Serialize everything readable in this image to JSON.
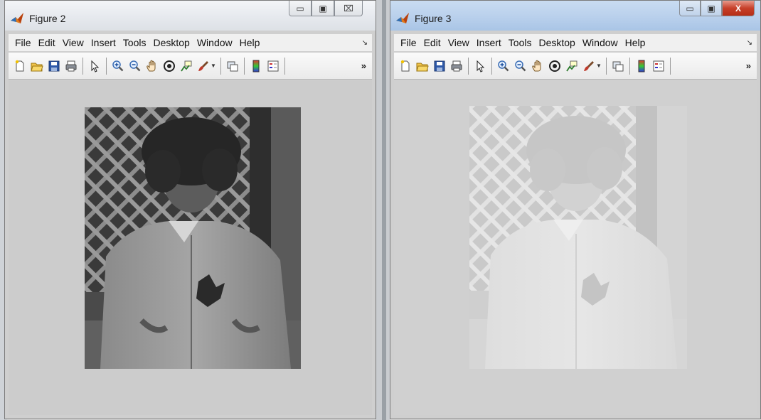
{
  "windows": [
    {
      "title": "Figure 2",
      "controls": {
        "minimize": "▭",
        "maximize": "▣",
        "close": "⌧"
      },
      "menu": [
        "File",
        "Edit",
        "View",
        "Insert",
        "Tools",
        "Desktop",
        "Window",
        "Help"
      ],
      "image": {
        "description_icon": "photo-image",
        "contrast": "normal"
      }
    },
    {
      "title": "Figure 3",
      "controls": {
        "minimize": "▭",
        "maximize": "▣",
        "close": "X"
      },
      "menu": [
        "File",
        "Edit",
        "View",
        "Insert",
        "Tools",
        "Desktop",
        "Window",
        "Help"
      ],
      "image": {
        "description_icon": "photo-image",
        "contrast": "low"
      }
    }
  ],
  "toolbar_icons": [
    "new-figure-icon",
    "open-file-icon",
    "save-icon",
    "print-icon",
    "edit-plot-arrow-icon",
    "zoom-in-icon",
    "zoom-out-icon",
    "pan-hand-icon",
    "rotate-3d-icon",
    "data-cursor-icon",
    "brush-icon",
    "link-plot-icon",
    "colorbar-icon",
    "legend-icon"
  ],
  "menu_dock_glyph": "↘",
  "toolbar_more_glyph": "»",
  "colors": {
    "accent_close": "#c7402a",
    "canvas": "#cccccc"
  }
}
